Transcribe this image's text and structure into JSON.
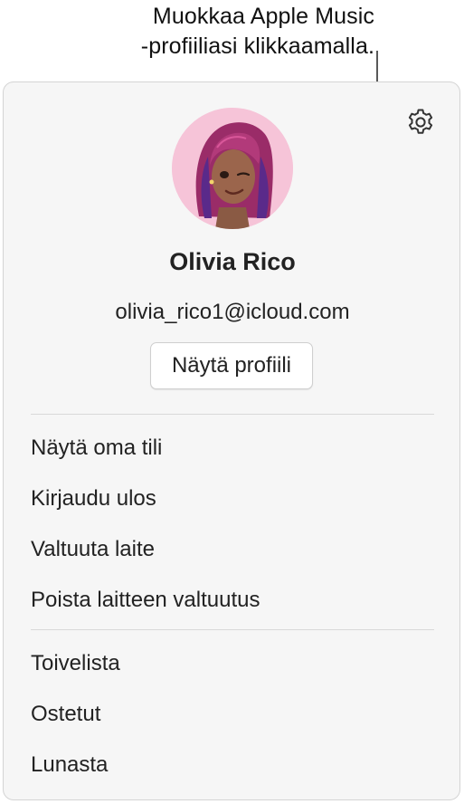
{
  "callout": {
    "line1": "Muokkaa Apple Music",
    "line2": "-profiiliasi klikkaamalla."
  },
  "account": {
    "name": "Olivia Rico",
    "email": "olivia_rico1@icloud.com",
    "view_profile_label": "Näytä profiili"
  },
  "menu": {
    "group1": [
      {
        "label": "Näytä oma tili"
      },
      {
        "label": "Kirjaudu ulos"
      },
      {
        "label": "Valtuuta laite"
      },
      {
        "label": "Poista laitteen valtuutus"
      }
    ],
    "group2": [
      {
        "label": "Toivelista"
      },
      {
        "label": "Ostetut"
      },
      {
        "label": "Lunasta"
      }
    ]
  },
  "icons": {
    "settings": "gear-icon",
    "avatar": "memoji-avatar"
  },
  "colors": {
    "panel_bg": "#f6f6f6",
    "avatar_bg": "#f6c4d8",
    "hair": "#a0306e"
  }
}
